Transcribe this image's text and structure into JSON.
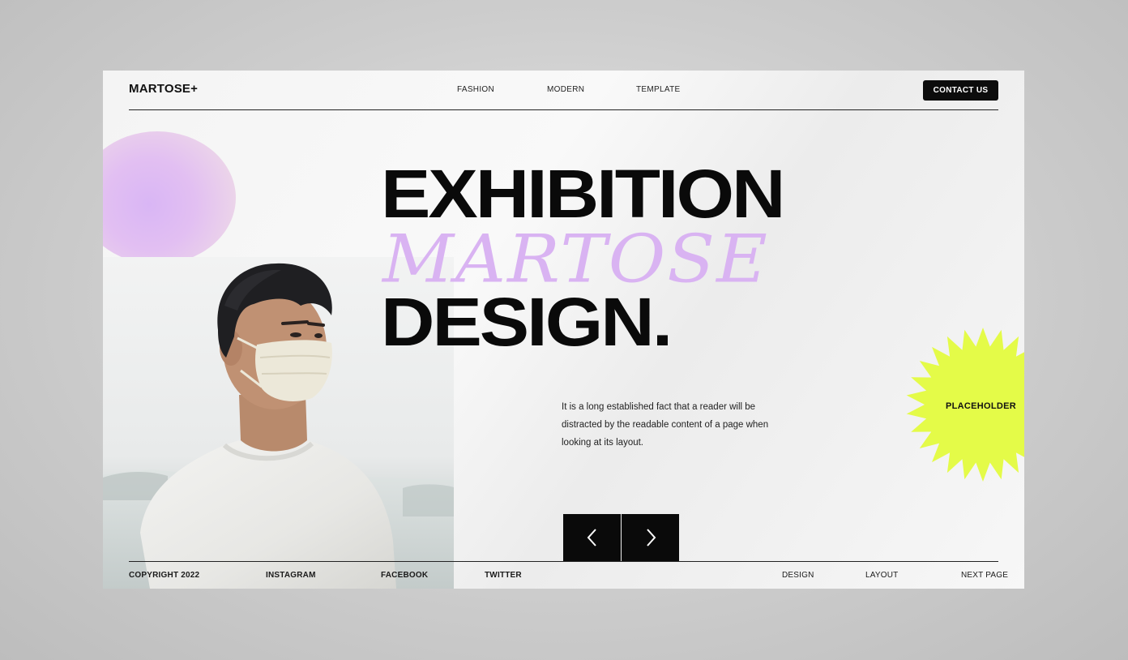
{
  "header": {
    "logo": "MARTOSE+",
    "nav": [
      "FASHION",
      "MODERN",
      "TEMPLATE"
    ],
    "contact_label": "CONTACT US"
  },
  "hero": {
    "line1": "EXHIBITION",
    "line2_script": "MARTOSE",
    "line3": "DESIGN.",
    "paragraph": "It is a long established fact that a reader will be distracted by the readable content of a page when looking at its layout.",
    "badge": "PLACEHOLDER"
  },
  "colors": {
    "accent_lilac": "#d9b3f2",
    "accent_lime": "#e4fb48",
    "ink": "#0a0a0a"
  },
  "carousel": {
    "prev_icon": "chevron-left-icon",
    "next_icon": "chevron-right-icon"
  },
  "footer": {
    "copyright": "COPYRIGHT 2022",
    "social": [
      "INSTAGRAM",
      "FACEBOOK",
      "TWITTER"
    ],
    "links": [
      "DESIGN",
      "LAYOUT",
      "NEXT PAGE"
    ]
  }
}
